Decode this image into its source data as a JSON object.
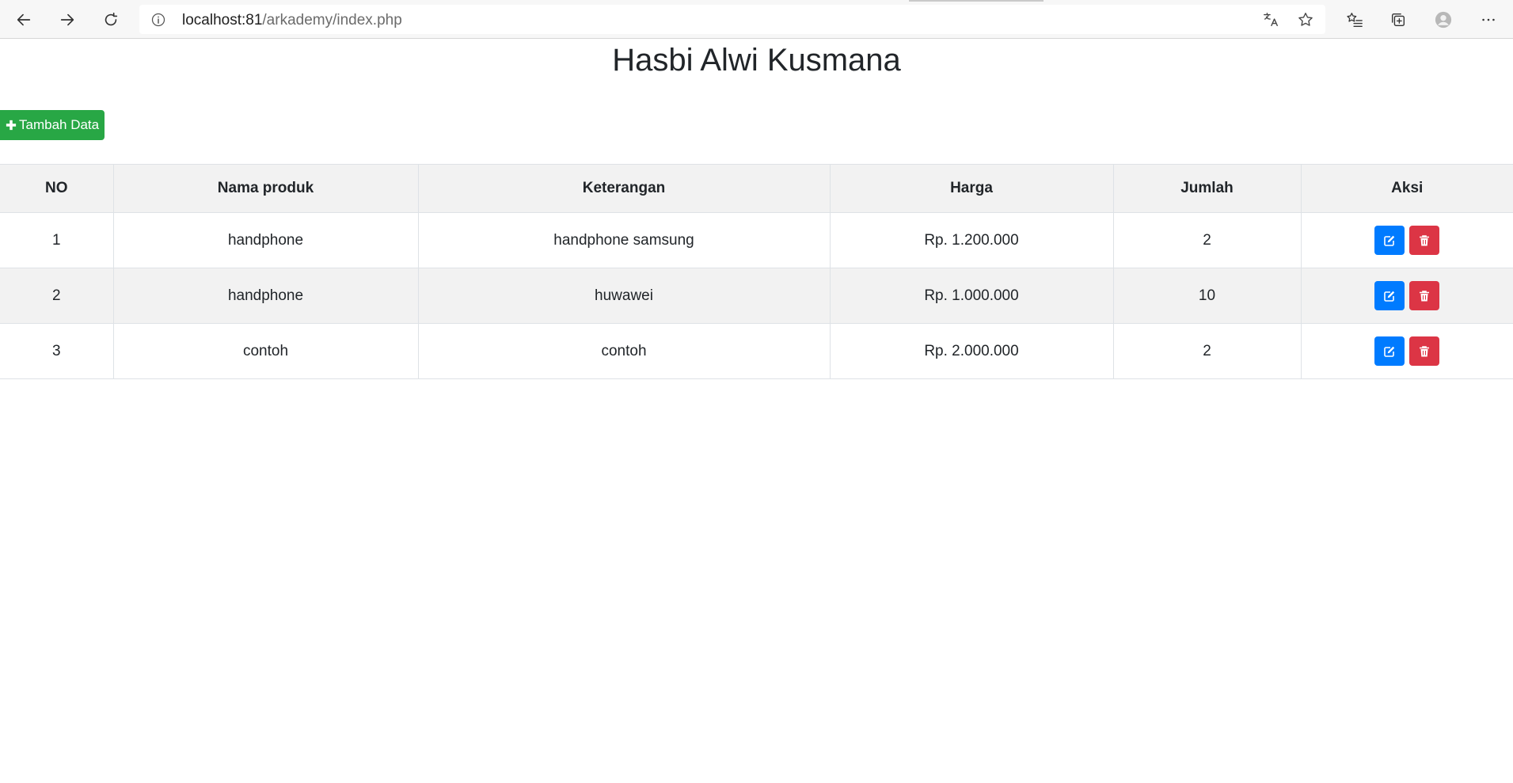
{
  "browser": {
    "url_host": "localhost:81",
    "url_path": "/arkademy/index.php"
  },
  "page": {
    "title": "Hasbi Alwi Kusmana",
    "add_button_label": "Tambah Data"
  },
  "table": {
    "headers": [
      "NO",
      "Nama produk",
      "Keterangan",
      "Harga",
      "Jumlah",
      "Aksi"
    ],
    "rows": [
      {
        "no": "1",
        "nama": "handphone",
        "keterangan": "handphone samsung",
        "harga": "Rp. 1.200.000",
        "jumlah": "2"
      },
      {
        "no": "2",
        "nama": "handphone",
        "keterangan": "huwawei",
        "harga": "Rp. 1.000.000",
        "jumlah": "10"
      },
      {
        "no": "3",
        "nama": "contoh",
        "keterangan": "contoh",
        "harga": "Rp. 2.000.000",
        "jumlah": "2"
      }
    ]
  },
  "colors": {
    "add_button": "#28a745",
    "edit_button": "#007bff",
    "delete_button": "#dc3545"
  },
  "icons": {
    "add": "plus-icon",
    "edit": "edit-icon",
    "delete": "trash-icon"
  }
}
